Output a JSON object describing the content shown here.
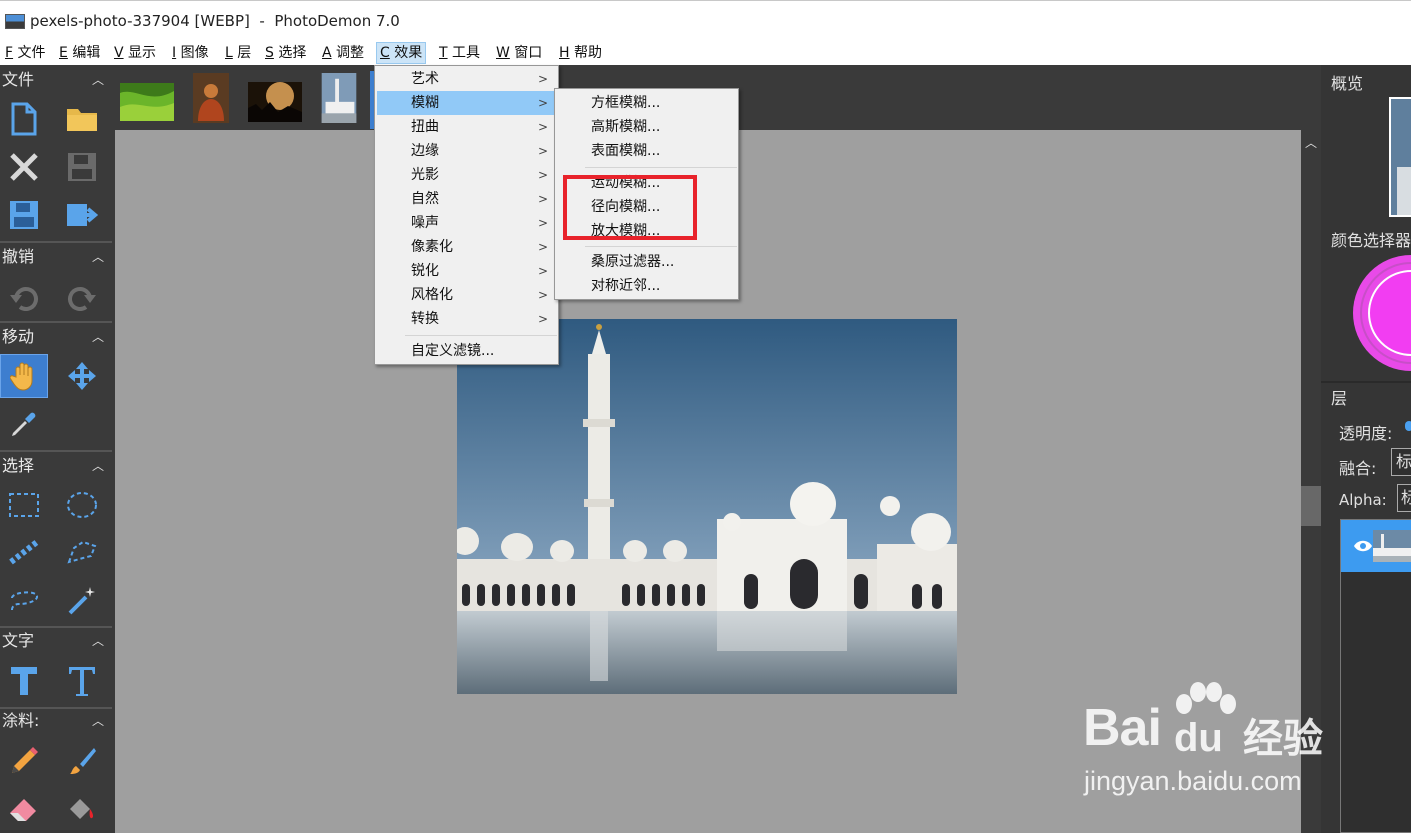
{
  "window": {
    "title": "pexels-photo-337904 [WEBP]  -  PhotoDemon 7.0"
  },
  "menubar": [
    {
      "key": "F",
      "label": "文件"
    },
    {
      "key": "E",
      "label": "编辑"
    },
    {
      "key": "V",
      "label": "显示"
    },
    {
      "key": "I",
      "label": "图像"
    },
    {
      "key": "L",
      "label": "层"
    },
    {
      "key": "S",
      "label": "选择"
    },
    {
      "key": "A",
      "label": "调整"
    },
    {
      "key": "C",
      "label": "效果"
    },
    {
      "key": "T",
      "label": "工具"
    },
    {
      "key": "W",
      "label": "窗口"
    },
    {
      "key": "H",
      "label": "帮助"
    }
  ],
  "toolbox": {
    "sections": {
      "file": "文件",
      "undo": "撤销",
      "move": "移动",
      "select": "选择",
      "text": "文字",
      "paint": "涂料:"
    }
  },
  "effects_menu": {
    "items": [
      "艺术",
      "模糊",
      "扭曲",
      "边缘",
      "光影",
      "自然",
      "噪声",
      "像素化",
      "锐化",
      "风格化",
      "转换"
    ],
    "custom": "自定义滤镜...",
    "highlighted": "模糊"
  },
  "blur_submenu": {
    "group1": [
      "方框模糊...",
      "高斯模糊...",
      "表面模糊..."
    ],
    "group2": [
      "运动模糊...",
      "径向模糊...",
      "放大模糊..."
    ],
    "group3": [
      "桑原过滤器...",
      "对称近邻..."
    ]
  },
  "right_panel": {
    "overview": "概览",
    "color_picker": "颜色选择器",
    "layers": "层",
    "opacity_label": "透明度:",
    "blend_label": "融合:",
    "blend_value": "标",
    "alpha_label": "Alpha:",
    "alpha_value": "标"
  },
  "watermark": {
    "brand": "Bai",
    "brand2": "du",
    "cn": "经验",
    "url": "jingyan.baidu.com"
  },
  "colors": {
    "accent": "#3d7ecf",
    "menu_highlight": "#91c9f7",
    "annotation_red": "#e8232b",
    "color_wheel": "#f23df2"
  }
}
